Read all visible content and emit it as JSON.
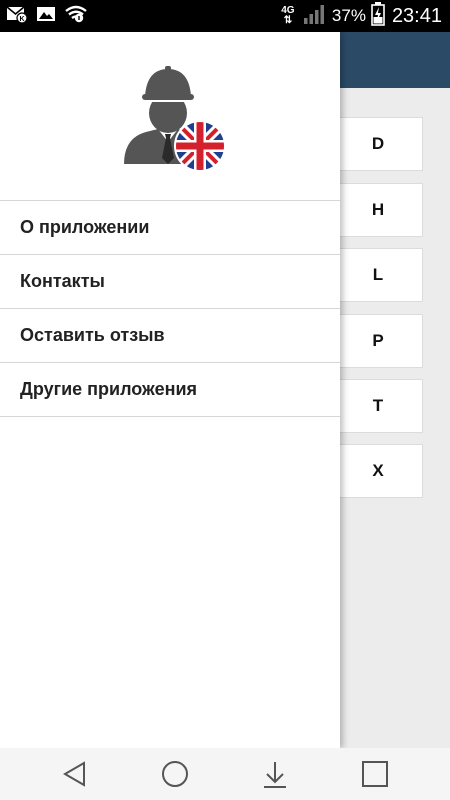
{
  "status_bar": {
    "icons_left": [
      "mail-notification-icon",
      "image-notification-icon",
      "wifi-icon"
    ],
    "network": "4G",
    "battery_percent": "37%",
    "time": "23:41",
    "icons_right": [
      "signal-icon",
      "battery-charging-icon"
    ]
  },
  "drawer": {
    "logo_icon": "worker-with-uk-flag-icon",
    "menu_items": [
      {
        "label": "О приложении"
      },
      {
        "label": "Контакты"
      },
      {
        "label": "Оставить отзыв"
      },
      {
        "label": "Другие приложения"
      }
    ]
  },
  "background_app": {
    "toolbar_color": "#2b4a66",
    "letters": [
      "D",
      "H",
      "L",
      "P",
      "T",
      "X"
    ]
  },
  "nav_bar": {
    "buttons": [
      "back-icon",
      "home-icon",
      "download-icon",
      "recents-icon"
    ]
  }
}
